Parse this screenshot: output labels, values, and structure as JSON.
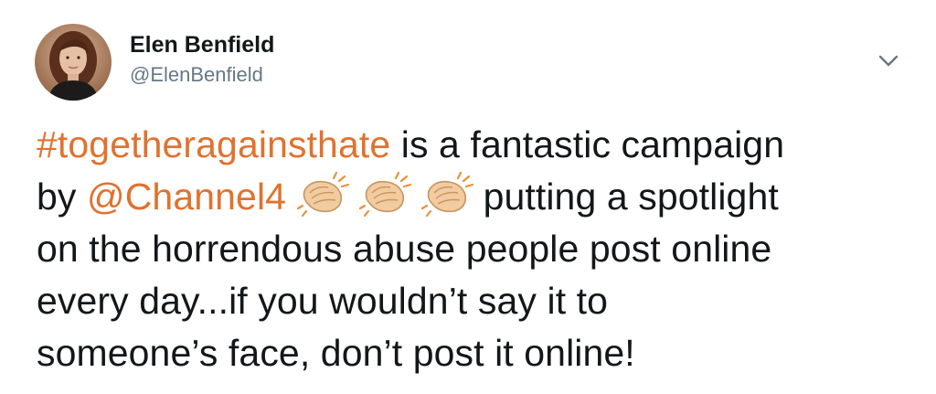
{
  "user": {
    "display_name": "Elen Benfield",
    "handle": "@ElenBenfield"
  },
  "tweet": {
    "hashtag": "#togetheragainsthate",
    "text_1": " is a fantastic campaign",
    "text_2_prefix": "by ",
    "mention": "@Channel4",
    "emoji": [
      "clapping-hands-light-skin",
      "clapping-hands-light-skin",
      "clapping-hands-light-skin"
    ],
    "text_2_suffix": "putting a spotlight",
    "line_3": "on the horrendous abuse people post online",
    "line_4": "every day...if you wouldn’t say it to",
    "line_5": "someone’s face, don’t post it online!"
  },
  "colors": {
    "link": "#e0722f",
    "text": "#14171a",
    "secondary": "#657786"
  },
  "icons": {
    "menu": "chevron-down-icon"
  }
}
